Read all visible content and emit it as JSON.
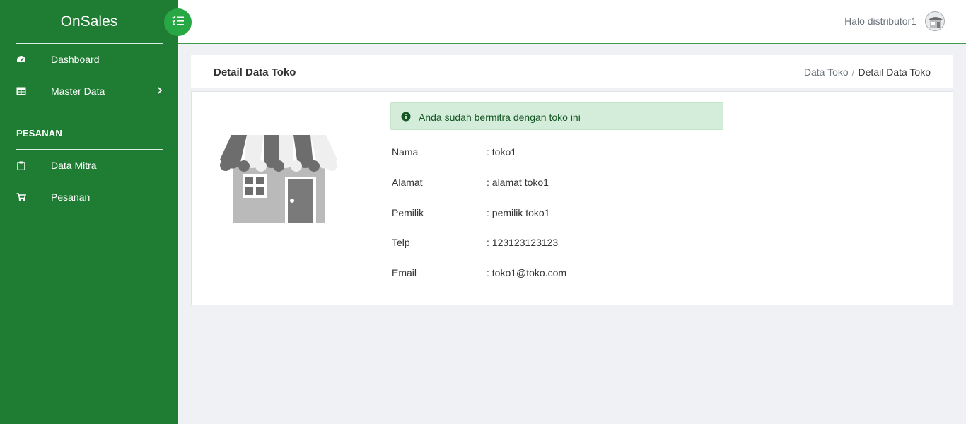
{
  "app": {
    "brand": "OnSales"
  },
  "sidebar": {
    "items": [
      {
        "label": "Dashboard",
        "icon": "tachometer-icon"
      },
      {
        "label": "Master Data",
        "icon": "table-icon",
        "has_submenu": true
      }
    ],
    "section_title": "PESANAN",
    "section_items": [
      {
        "label": "Data Mitra",
        "icon": "clipboard-icon"
      },
      {
        "label": "Pesanan",
        "icon": "cart-icon"
      }
    ]
  },
  "topbar": {
    "greeting": "Halo distributor1"
  },
  "page": {
    "title": "Detail Data Toko",
    "breadcrumb": {
      "parent": "Data Toko",
      "separator": "/",
      "current": "Detail Data Toko"
    }
  },
  "alert": {
    "text": "Anda sudah bermitra dengan toko ini"
  },
  "details": [
    {
      "key": "Nama",
      "value": ": toko1"
    },
    {
      "key": "Alamat",
      "value": ": alamat toko1"
    },
    {
      "key": "Pemilik",
      "value": ": pemilik toko1"
    },
    {
      "key": "Telp",
      "value": ": 123123123123"
    },
    {
      "key": "Email",
      "value": ": toko1@toko.com"
    }
  ],
  "colors": {
    "sidebar": "#1f7d33",
    "toggle": "#28a745",
    "alert_bg": "#d4edda",
    "alert_text": "#155724",
    "background": "#f0f1f5"
  }
}
